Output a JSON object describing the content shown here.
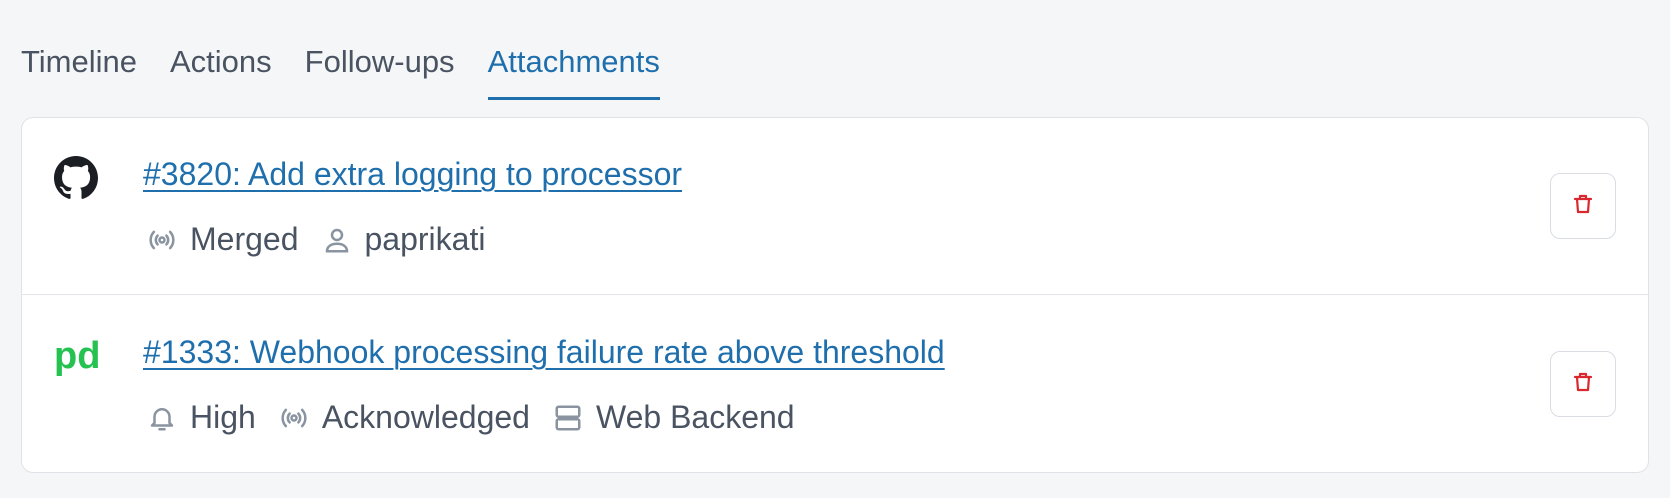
{
  "tabs": [
    {
      "label": "Timeline",
      "active": false
    },
    {
      "label": "Actions",
      "active": false
    },
    {
      "label": "Follow-ups",
      "active": false
    },
    {
      "label": "Attachments",
      "active": true
    }
  ],
  "attachments": [
    {
      "source_icon": "github-icon",
      "title": "#3820: Add extra logging to processor",
      "status": "Merged",
      "author": "paprikati"
    },
    {
      "source_icon": "pagerduty-icon",
      "title": "#1333: Webhook processing failure rate above threshold",
      "urgency": "High",
      "status": "Acknowledged",
      "service": "Web Backend"
    }
  ],
  "colors": {
    "accent": "#1f6fad",
    "delete": "#d9282f",
    "pagerduty": "#25c151"
  }
}
